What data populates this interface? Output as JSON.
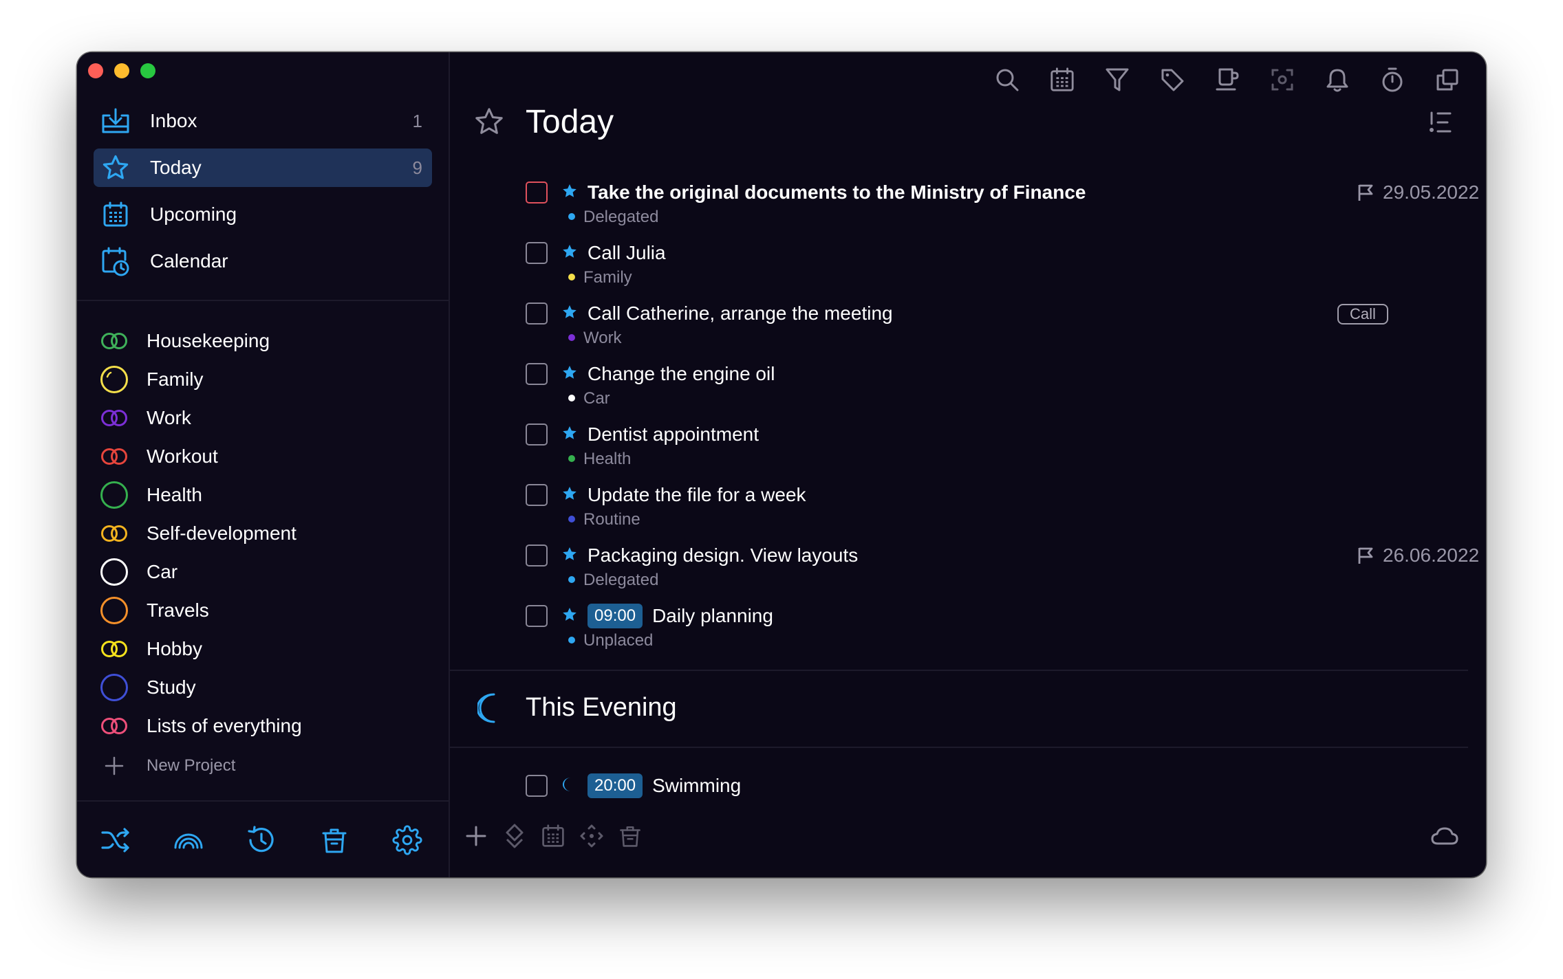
{
  "colors": {
    "background": "#0b0817",
    "sidebar_background": "#0d0a1a",
    "accent": "#2ea7f2",
    "active_item": "#1f3258",
    "time_badge": "#1d5f93"
  },
  "sidebar": {
    "nav": [
      {
        "label": "Inbox",
        "count": "1",
        "icon": "inbox-icon"
      },
      {
        "label": "Today",
        "count": "9",
        "icon": "star-icon",
        "active": true
      },
      {
        "label": "Upcoming",
        "count": "",
        "icon": "calendar-grid-icon"
      },
      {
        "label": "Calendar",
        "count": "",
        "icon": "calendar-clock-icon"
      }
    ],
    "projects": [
      {
        "label": "Housekeeping",
        "color": "#3fb15a",
        "icon": "double-ring-icon"
      },
      {
        "label": "Family",
        "color": "#f4df4a",
        "icon": "ring-icon"
      },
      {
        "label": "Work",
        "color": "#7c2fd6",
        "icon": "double-ring-icon"
      },
      {
        "label": "Workout",
        "color": "#e5453c",
        "icon": "double-ring-icon"
      },
      {
        "label": "Health",
        "color": "#35b04e",
        "icon": "ring-icon"
      },
      {
        "label": "Self-development",
        "color": "#f3b31f",
        "icon": "double-ring-icon"
      },
      {
        "label": "Car",
        "color": "#ffffff",
        "icon": "ring-icon"
      },
      {
        "label": "Travels",
        "color": "#f5902a",
        "icon": "ring-icon"
      },
      {
        "label": "Hobby",
        "color": "#f6e21c",
        "icon": "double-ring-icon"
      },
      {
        "label": "Study",
        "color": "#3f4fd6",
        "icon": "ring-icon"
      },
      {
        "label": "Lists of everything",
        "color": "#ee4f7a",
        "icon": "double-ring-icon"
      }
    ],
    "new_project_label": "New Project",
    "footer_icons": [
      "shuffle-icon",
      "rainbow-icon",
      "history-icon",
      "trash-icon",
      "settings-icon"
    ]
  },
  "main": {
    "toolbar_icons": [
      "search-icon",
      "calendar-icon",
      "filter-icon",
      "tag-icon",
      "coffee-icon",
      "focus-icon",
      "bell-icon",
      "timer-icon",
      "copy-icon"
    ],
    "title": "Today",
    "tasks": [
      {
        "title": "Take the original documents to the Ministry of Finance",
        "project": "Delegated",
        "dot": "#2ea7f2",
        "date": "29.05.2022",
        "bold": true,
        "red": true
      },
      {
        "title": "Call Julia",
        "project": "Family",
        "dot": "#f4df4a"
      },
      {
        "title": "Call Catherine, arrange the meeting",
        "project": "Work",
        "dot": "#7c2fd6",
        "tag": "Call"
      },
      {
        "title": "Change the engine oil",
        "project": "Car",
        "dot": "#ffffff"
      },
      {
        "title": "Dentist appointment",
        "project": "Health",
        "dot": "#35b04e"
      },
      {
        "title": "Update the file for a week",
        "project": "Routine",
        "dot": "#3f4fd6"
      },
      {
        "title": "Packaging design. View layouts",
        "project": "Delegated",
        "dot": "#2ea7f2",
        "date": "26.06.2022"
      },
      {
        "title": "Daily planning",
        "project": "Unplaced",
        "dot": "#2ea7f2",
        "time": "09:00"
      }
    ],
    "evening_title": "This Evening",
    "evening_tasks": [
      {
        "title": "Swimming",
        "time": "20:00"
      }
    ],
    "footer_icons": [
      "add-icon",
      "move-icon",
      "calendar-icon",
      "arrows-icon",
      "trash-icon",
      "cloud-icon"
    ]
  }
}
